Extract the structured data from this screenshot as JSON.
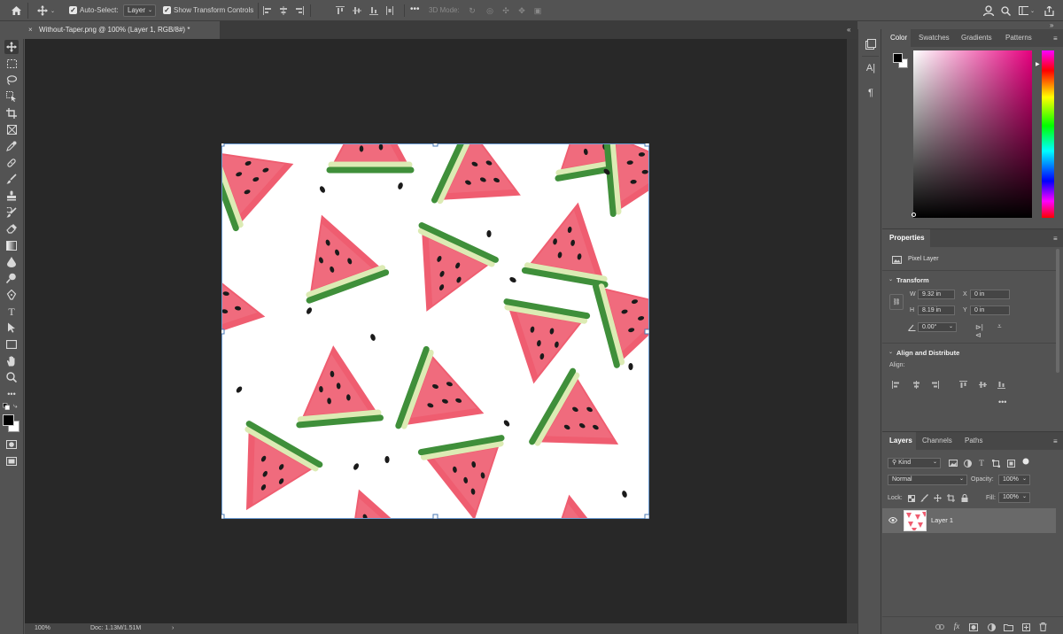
{
  "options_bar": {
    "auto_select_label": "Auto-Select:",
    "auto_select_value": "Layer",
    "show_transform_label": "Show Transform Controls",
    "mode_3d_label": "3D Mode:",
    "more_label": "•••"
  },
  "document": {
    "tab_title": "Without-Taper.png @ 100% (Layer 1, RGB/8#) *",
    "close_glyph": "×"
  },
  "status_bar": {
    "zoom": "100%",
    "doc_size": "Doc: 1.13M/1.51M",
    "arrow": "›"
  },
  "color_panel": {
    "tabs": [
      "Color",
      "Swatches",
      "Gradients",
      "Patterns"
    ],
    "active_tab": "Color"
  },
  "properties_panel": {
    "title": "Properties",
    "layer_type": "Pixel Layer",
    "transform_label": "Transform",
    "w_label": "W",
    "w_value": "9.32 in",
    "h_label": "H",
    "h_value": "8.19 in",
    "x_label": "X",
    "x_value": "0 in",
    "y_label": "Y",
    "y_value": "0 in",
    "angle_value": "0.00°",
    "align_label": "Align and Distribute",
    "align_sub": "Align:",
    "more": "•••"
  },
  "layers_panel": {
    "tabs": [
      "Layers",
      "Channels",
      "Paths"
    ],
    "active_tab": "Layers",
    "filter_kind": "Kind",
    "blend_mode": "Normal",
    "opacity_label": "Opacity:",
    "opacity_value": "100%",
    "lock_label": "Lock:",
    "fill_label": "Fill:",
    "fill_value": "100%",
    "layers": [
      {
        "name": "Layer 1",
        "visible": true,
        "selected": true
      }
    ],
    "footer_icons": [
      "link-icon",
      "fx-icon",
      "mask-icon",
      "adjustment-icon",
      "folder-icon",
      "new-layer-icon",
      "trash-icon"
    ]
  },
  "colors": {
    "ui_bg": "#535353",
    "canvas_bg": "#282828",
    "watermelon_flesh": "#ee5a6f",
    "rind_light": "#dcebb4",
    "rind_dark": "#3f8f3a"
  }
}
